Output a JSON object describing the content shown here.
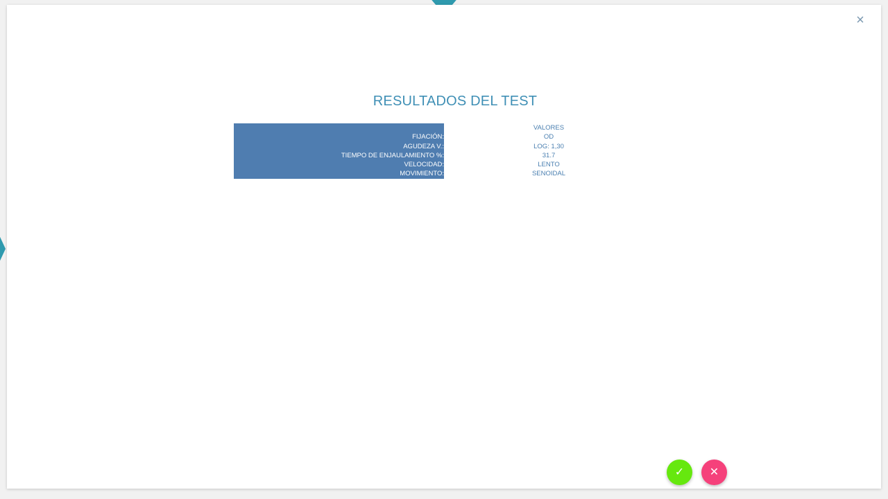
{
  "modal": {
    "close_glyph": "×",
    "title": "RESULTADOS DEL TEST"
  },
  "results": {
    "header_label": "",
    "header_value": "VALORES",
    "rows": [
      {
        "label": "FIJACIÓN:",
        "value": "OD"
      },
      {
        "label": "AGUDEZA V.:",
        "value": "LOG: 1,30"
      },
      {
        "label": "TIEMPO DE ENJAULAMIENTO %:",
        "value": "31.7"
      },
      {
        "label": "VELOCIDAD:",
        "value": "LENTO"
      },
      {
        "label": "MOVIMIENTO:",
        "value": "SENOIDAL"
      }
    ]
  },
  "actions": {
    "confirm_glyph": "✓",
    "cancel_glyph": "✕"
  },
  "colors": {
    "accent": "#3f8fb5",
    "label_bg": "#4f7db0",
    "confirm": "#66e80f",
    "cancel": "#f5417b"
  }
}
